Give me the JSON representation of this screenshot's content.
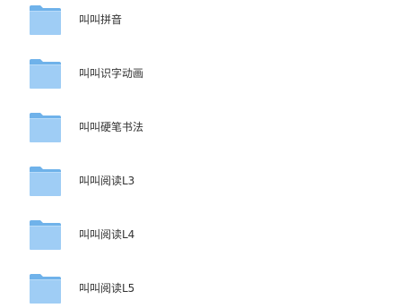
{
  "folders": [
    {
      "name": "叫叫拼音",
      "icon": "folder-icon"
    },
    {
      "name": "叫叫识字动画",
      "icon": "folder-icon"
    },
    {
      "name": "叫叫硬笔书法",
      "icon": "folder-icon"
    },
    {
      "name": "叫叫阅读L3",
      "icon": "folder-icon"
    },
    {
      "name": "叫叫阅读L4",
      "icon": "folder-icon"
    },
    {
      "name": "叫叫阅读L5",
      "icon": "folder-icon"
    }
  ],
  "colors": {
    "folder_back": "#6fb2ea",
    "folder_front": "#9fcdf5",
    "text": "#333333"
  }
}
